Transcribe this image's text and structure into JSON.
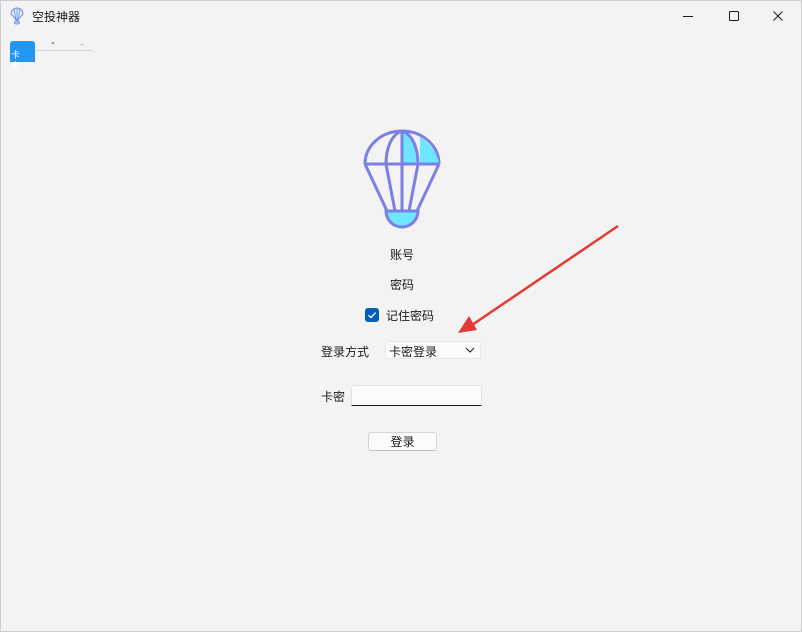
{
  "window": {
    "title": "空投神器",
    "icons": {
      "app": "parachute-icon",
      "minimize": "minimize-icon",
      "maximize": "maximize-icon",
      "close": "close-icon"
    }
  },
  "tabs": {
    "active_label": "卡\n密",
    "mark1": "\"",
    "mark2": "⁻"
  },
  "form": {
    "account_label": "账号",
    "password_label": "密码",
    "remember": {
      "label": "记住密码",
      "checked": true
    },
    "login_mode": {
      "label": "登录方式",
      "selected": "卡密登录"
    },
    "card": {
      "label": "卡密",
      "value": "",
      "placeholder": ""
    },
    "login_button": "登录"
  },
  "colors": {
    "accent": "#005fb8",
    "tab_blue": "#2196f3",
    "logo_stroke": "#7b7fe6",
    "logo_fill": "#6ee6ff",
    "annotation": "#e53935"
  }
}
